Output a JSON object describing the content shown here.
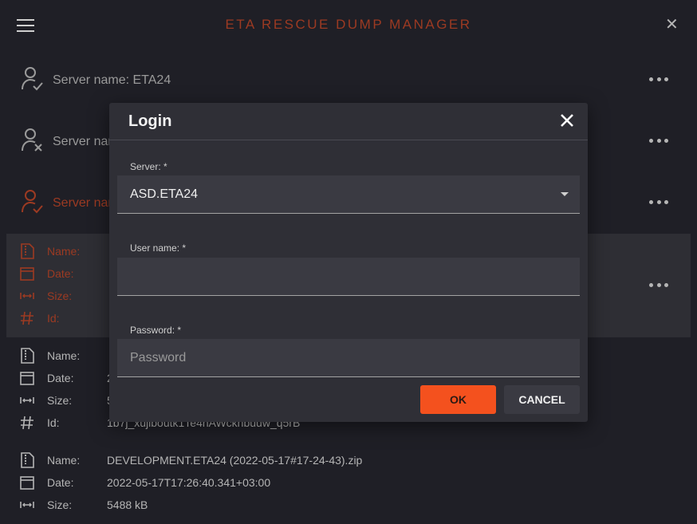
{
  "app": {
    "title": "ETA RESCUE DUMP MANAGER",
    "menu_icon": "hamburger-menu-icon",
    "close_icon": "close-icon"
  },
  "servers": [
    {
      "label": "Server name: ETA24",
      "status": "connected",
      "icon": "user-check-icon"
    },
    {
      "label": "Server name",
      "status": "disconnected",
      "icon": "user-x-icon"
    },
    {
      "label": "Server name",
      "status": "active",
      "icon": "user-check-icon"
    }
  ],
  "dump_labels": {
    "name": "Name:",
    "date": "Date:",
    "size": "Size:",
    "id": "Id:"
  },
  "dumps": [
    {
      "selected": true,
      "name": "",
      "date": "",
      "size": "",
      "id": ""
    },
    {
      "selected": false,
      "name": "",
      "date": "2",
      "size": "5",
      "id": "1b7j_xujiboutk1Te4nAWckhbuuw_q5rB"
    },
    {
      "selected": false,
      "name": "DEVELOPMENT.ETA24 (2022-05-17#17-24-43).zip",
      "date": "2022-05-17T17:26:40.341+03:00",
      "size": "5488 kB",
      "id": ""
    }
  ],
  "login": {
    "title": "Login",
    "server_label": "Server: *",
    "server_value": "ASD.ETA24",
    "username_label": "User name: *",
    "username_value": "",
    "password_label": "Password: *",
    "password_placeholder": "Password",
    "ok_label": "OK",
    "cancel_label": "CANCEL"
  },
  "colors": {
    "background": "#1f1f26",
    "accent": "#9c3a22",
    "ok_button": "#f4511e",
    "modal": "#2f2f36"
  }
}
